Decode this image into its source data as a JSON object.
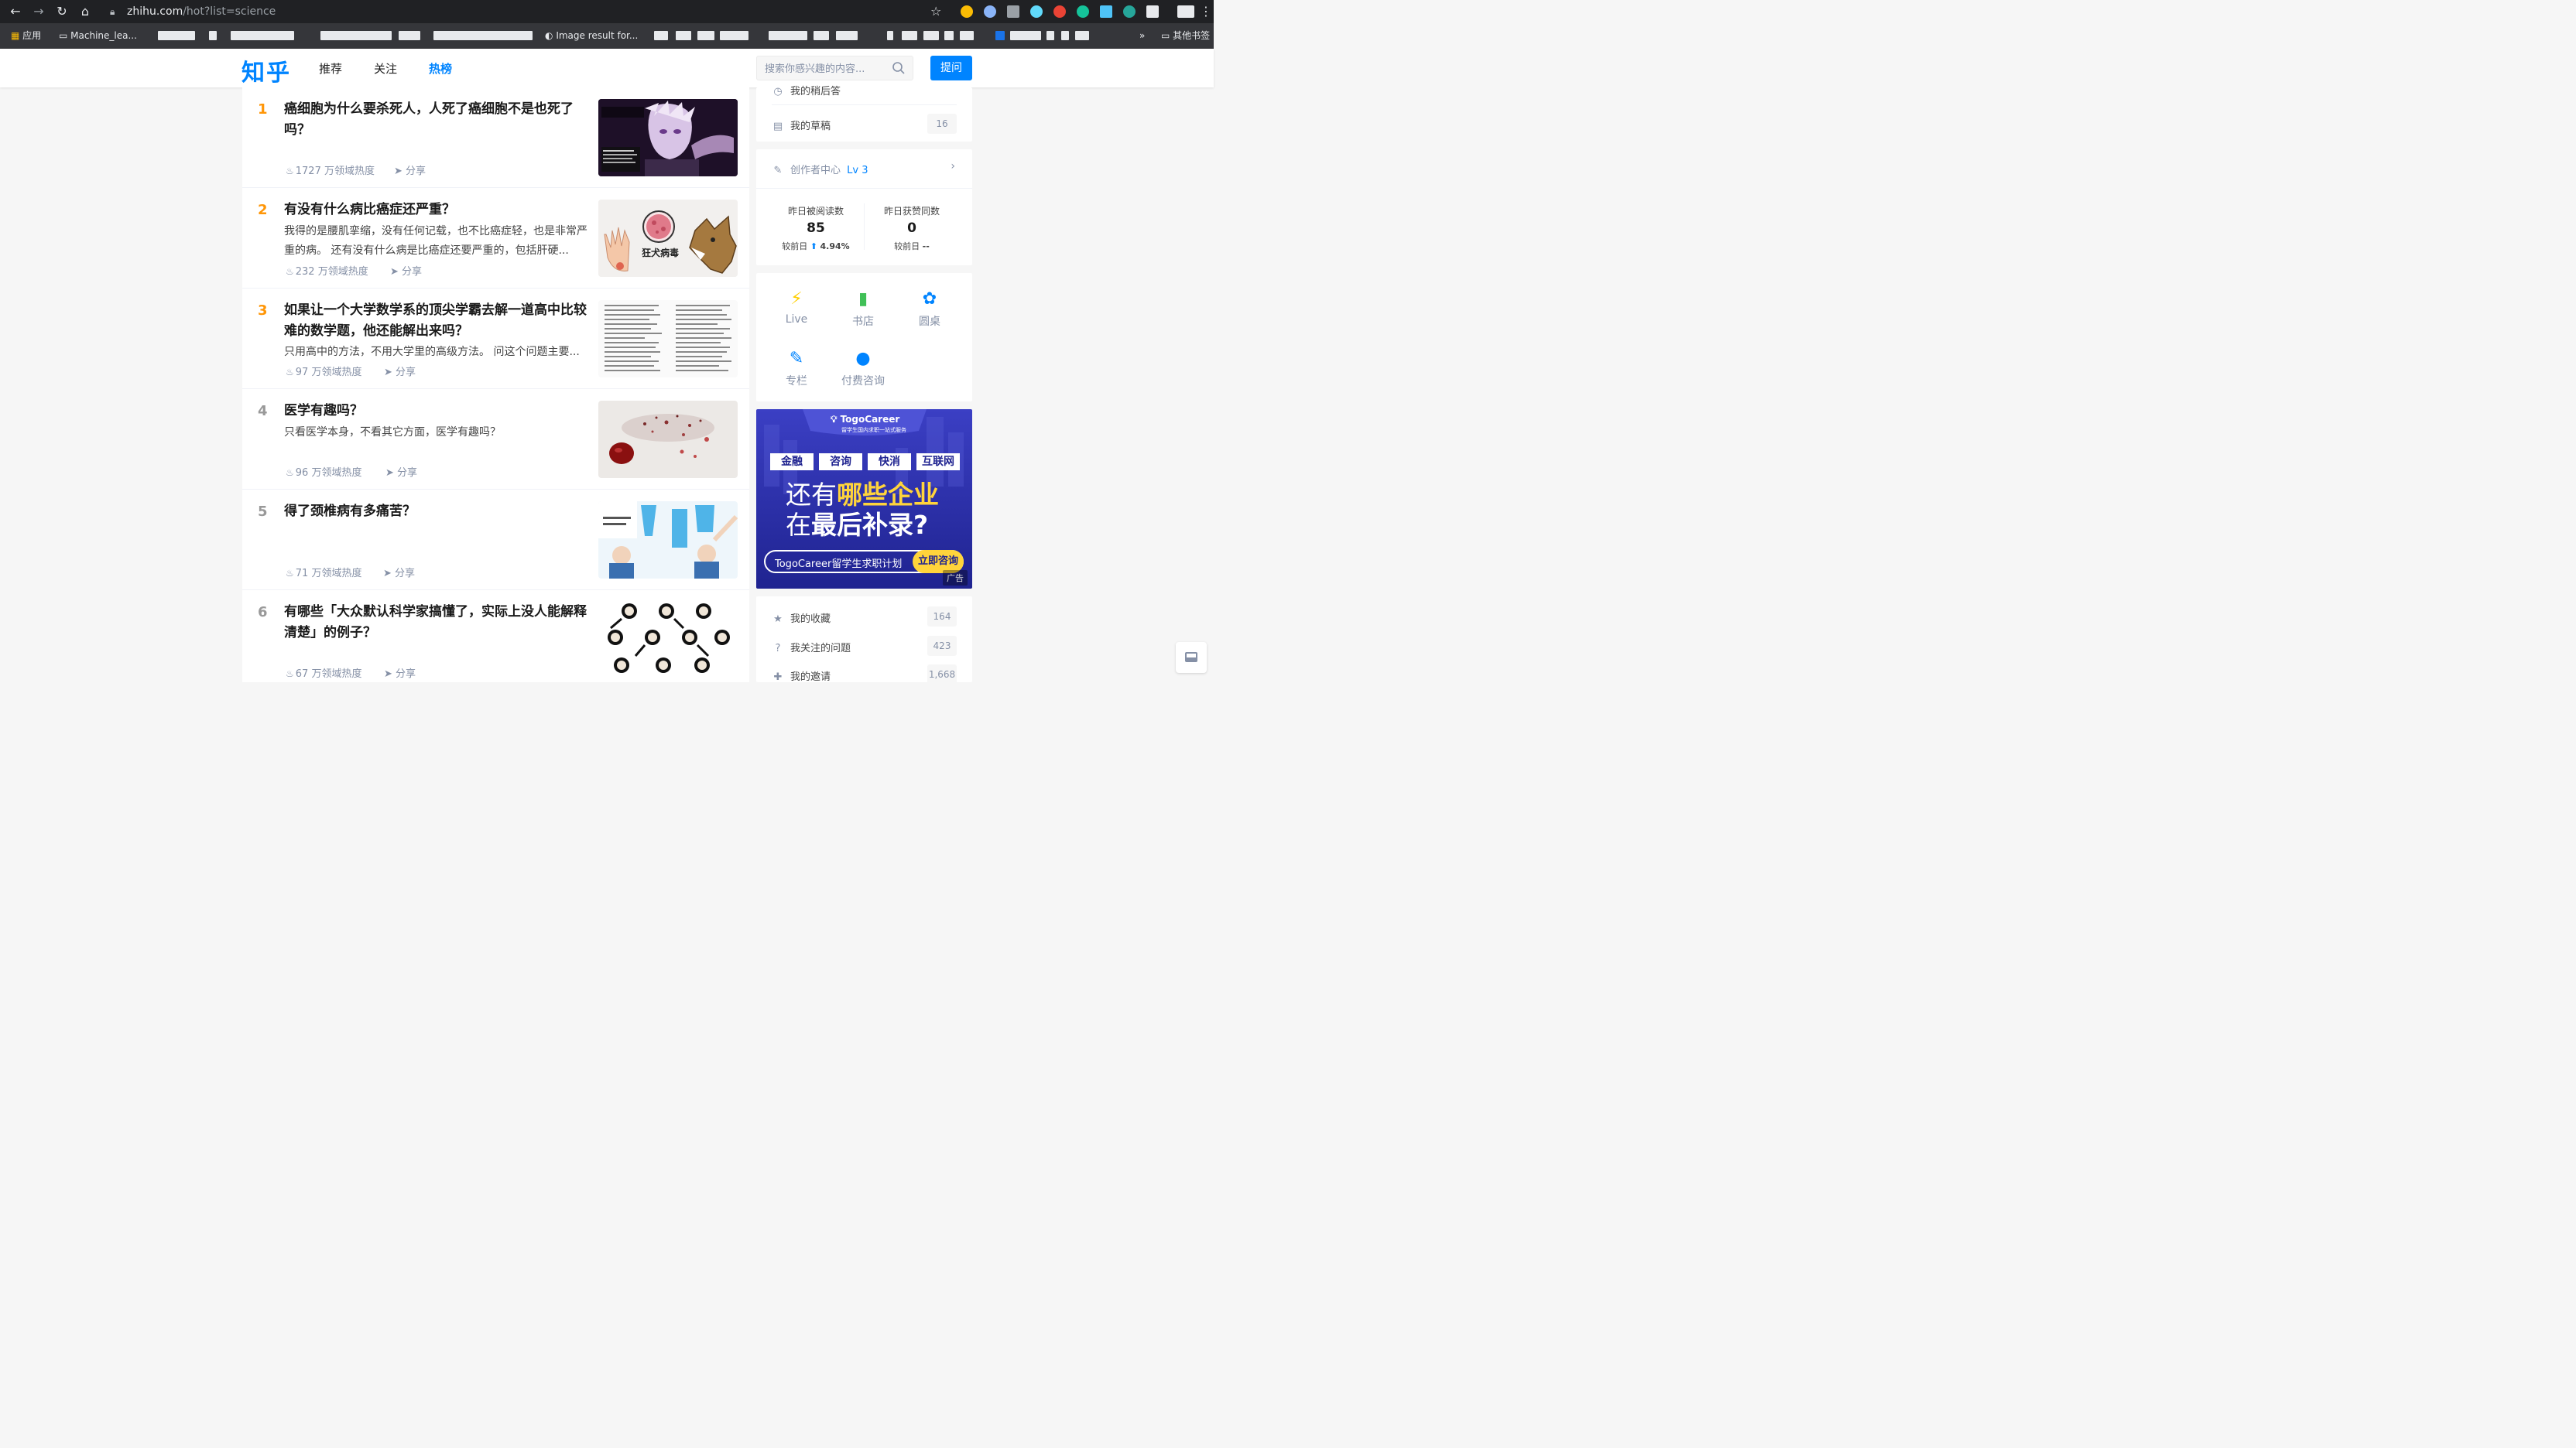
{
  "browser": {
    "url_host": "zhihu.com",
    "url_path": "/hot?list=science",
    "bookmarks": [
      {
        "label": "应用"
      },
      {
        "label": "Machine_lea..."
      },
      {
        "label": "Image result for..."
      }
    ],
    "other_bookmarks": "其他书签",
    "overflow": "»"
  },
  "header": {
    "logo": "知乎",
    "tabs": [
      {
        "label": "推荐"
      },
      {
        "label": "关注"
      },
      {
        "label": "热榜",
        "active": true
      }
    ],
    "search_placeholder": "搜索你感兴趣的内容...",
    "ask_button": "提问",
    "accent": "#0084ff"
  },
  "hot_list": [
    {
      "rank": "1",
      "title": "癌细胞为什么要杀死人，人死了癌细胞不是也死了吗？",
      "excerpt": "",
      "heat": "1727 万领域热度",
      "share": "分享",
      "thumb": "anime-character"
    },
    {
      "rank": "2",
      "title": "有没有什么病比癌症还严重？",
      "excerpt": "我得的是腰肌挛缩，没有任何记载，也不比癌症轻，也是非常严重的病。 还有没有什么病是比癌症还要严重的，包括肝硬...",
      "heat": "232 万领域热度",
      "share": "分享",
      "thumb": "rabies",
      "thumb_caption": "狂犬病毒"
    },
    {
      "rank": "3",
      "title": "如果让一个大学数学系的顶尖学霸去解一道高中比较难的数学题，他还能解出来吗？",
      "excerpt": "只用高中的方法，不用大学里的高级方法。 问这个问题主要...",
      "heat": "97 万领域热度",
      "share": "分享",
      "thumb": "math-text"
    },
    {
      "rank": "4",
      "title": "医学有趣吗？",
      "excerpt": "只看医学本身，不看其它方面，医学有趣吗？",
      "heat": "96 万领域热度",
      "share": "分享",
      "thumb": "blood-drop"
    },
    {
      "rank": "5",
      "title": "得了颈椎病有多痛苦？",
      "excerpt": "",
      "heat": "71 万领域热度",
      "share": "分享",
      "thumb": "stretch-manga"
    },
    {
      "rank": "6",
      "title": "有哪些「大众默认科学家搞懂了，实际上没人能解释清楚」的例子？",
      "excerpt": "",
      "heat": "67 万领域热度",
      "share": "分享",
      "thumb": "panda-meme"
    }
  ],
  "sidebar": {
    "top_card": [
      {
        "icon": "clock-icon",
        "label": "我的稍后答",
        "count": ""
      },
      {
        "icon": "drafts-icon",
        "label": "我的草稿",
        "count": "16"
      }
    ],
    "creator": {
      "label": "创作者中心",
      "level": "Lv 3",
      "stats": [
        {
          "label": "昨日被阅读数",
          "value": "85",
          "compare_label": "较前日",
          "change": "4.94%",
          "trend": "up"
        },
        {
          "label": "昨日获赞同数",
          "value": "0",
          "compare_label": "较前日",
          "change": "--",
          "trend": "none"
        }
      ]
    },
    "tools": [
      {
        "icon": "lightning-icon",
        "label": "Live",
        "color": "#ffcf00"
      },
      {
        "icon": "book-icon",
        "label": "书店",
        "color": "#40c057"
      },
      {
        "icon": "roundtable-icon",
        "label": "圆桌",
        "color": "#0084ff"
      },
      {
        "icon": "pen-icon",
        "label": "专栏",
        "color": "#0084ff"
      },
      {
        "icon": "paid-consult-icon",
        "label": "付费咨询",
        "color": "#0084ff"
      }
    ],
    "ad": {
      "brand": "TogoCareer",
      "brand_sub": "留学生国内求职一站式服务",
      "tags": [
        "金融",
        "咨询",
        "快消",
        "互联网"
      ],
      "headline_1_plain": "还有",
      "headline_1_hl": "哪些企业",
      "headline_2_plain": "在",
      "headline_2_hl": "最后补录?",
      "bar_text": "TogoCareer留学生求职计划",
      "cta": "立即咨询",
      "ad_label": "广告"
    },
    "bottom_card": [
      {
        "icon": "star-icon",
        "label": "我的收藏",
        "count": "164"
      },
      {
        "icon": "question-icon",
        "label": "我关注的问题",
        "count": "423"
      },
      {
        "icon": "invite-icon",
        "label": "我的邀请",
        "count": "1,668"
      }
    ]
  }
}
